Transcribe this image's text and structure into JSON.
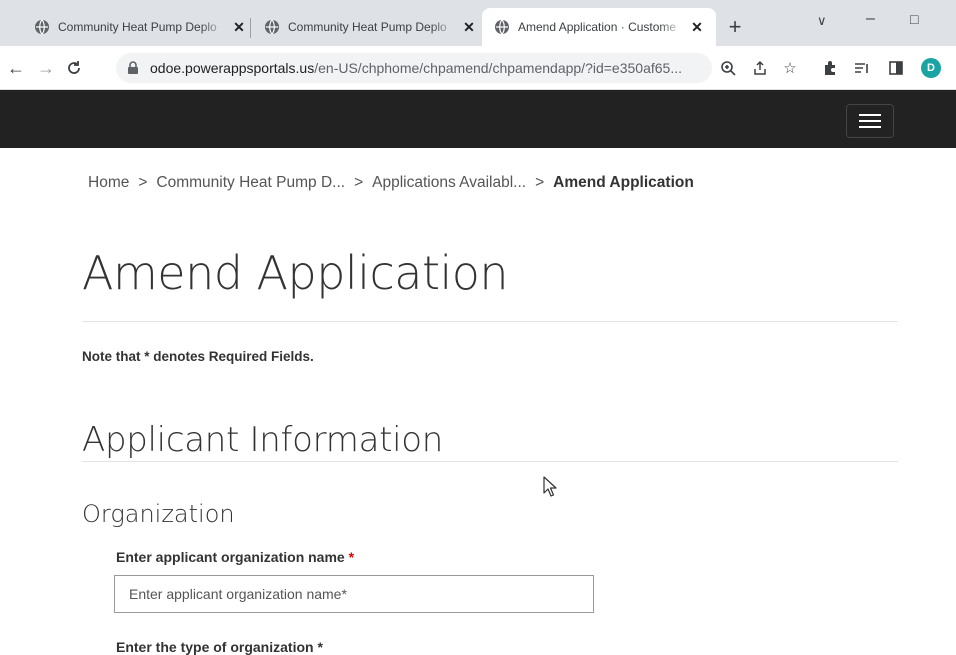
{
  "browser": {
    "tabs": [
      {
        "title": "Community Heat Pump Deplo",
        "active": false
      },
      {
        "title": "Community Heat Pump Deplo",
        "active": false
      },
      {
        "title": "Amend Application · Custome",
        "active": true
      }
    ],
    "new_tab": "+",
    "window_controls": {
      "minimize": "–",
      "maximize": "□",
      "chevron": "∨"
    },
    "url": {
      "domain": "odoe.powerappsportals.us",
      "path": "/en-US/chphome/chpamend/chpamendapp/?id=e350af65..."
    },
    "profile_initial": "D"
  },
  "breadcrumb": {
    "items": [
      "Home",
      "Community Heat Pump D...",
      "Applications Availabl..."
    ],
    "separator": ">",
    "current": "Amend Application"
  },
  "page": {
    "title": "Amend Application",
    "note": "Note that * denotes Required Fields.",
    "section_title": "Applicant Information",
    "subsection_title": "Organization",
    "field_org_label": "Enter applicant organization name",
    "required_marker": "*",
    "field_org_placeholder": "Enter applicant organization name*",
    "field_next_label": "Enter the type of organization *"
  },
  "colors": {
    "tabstrip": "#dee1e6",
    "site_header": "#222222",
    "profile": "#1aa3a3",
    "required": "#dd0000"
  }
}
